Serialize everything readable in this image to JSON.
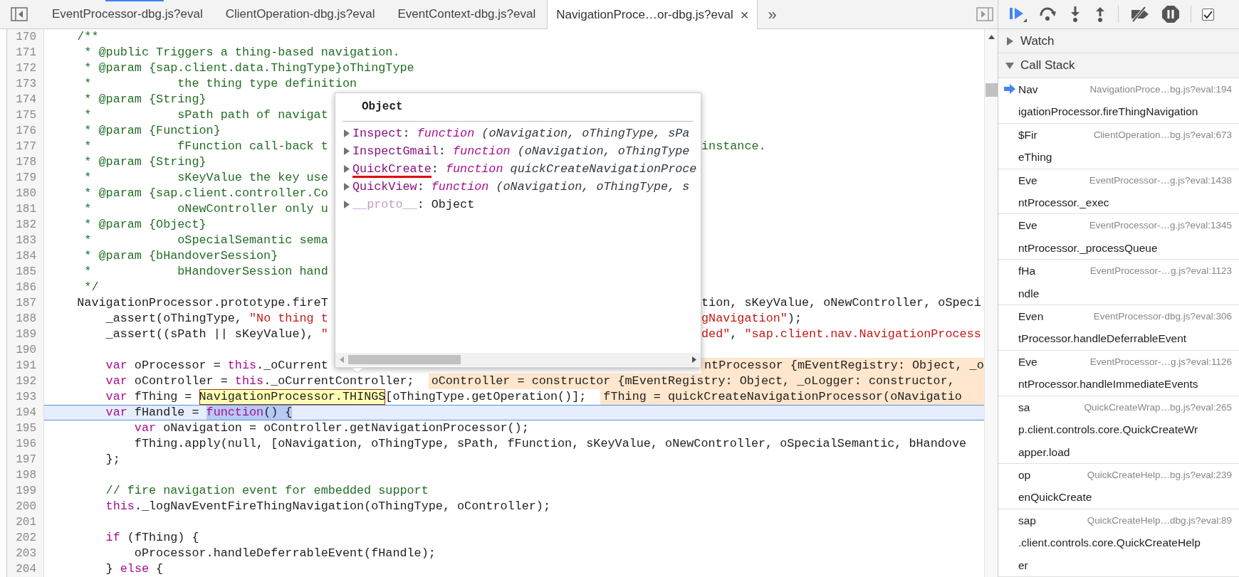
{
  "editor": {
    "tabs": [
      {
        "label": "EventProcessor-dbg.js?eval",
        "selected": false
      },
      {
        "label": "ClientOperation-dbg.js?eval",
        "selected": false
      },
      {
        "label": "EventContext-dbg.js?eval",
        "selected": false
      },
      {
        "label": "NavigationProce…or-dbg.js?eval",
        "selected": true,
        "close": "×"
      }
    ],
    "more": "»",
    "lines": [
      {
        "number": "170",
        "current": false,
        "left": [
          {
            "text": "    /**",
            "kind": "comment"
          }
        ]
      },
      {
        "number": "171",
        "current": false,
        "left": [
          {
            "text": "     * @public Triggers a thing-based navigation.",
            "kind": "comment"
          }
        ]
      },
      {
        "number": "172",
        "current": false,
        "left": [
          {
            "text": "     * @param {sap.client.data.ThingType}oThingType",
            "kind": "comment"
          }
        ]
      },
      {
        "number": "173",
        "current": false,
        "left": [
          {
            "text": "     *            the thing type definition",
            "kind": "comment"
          }
        ]
      },
      {
        "number": "174",
        "current": false,
        "left": [
          {
            "text": "     * @param {String}",
            "kind": "comment"
          }
        ]
      },
      {
        "number": "175",
        "current": false,
        "left": [
          {
            "text": "     *            sPath path of navigat",
            "kind": "comment"
          }
        ]
      },
      {
        "number": "176",
        "current": false,
        "left": [
          {
            "text": "     * @param {Function}",
            "kind": "comment"
          }
        ]
      },
      {
        "number": "177",
        "current": false,
        "left": [
          {
            "text": "     *            fFunction call-back t",
            "kind": "comment"
          }
        ],
        "right": [
          {
            "text": "instance.",
            "kind": "comment"
          }
        ]
      },
      {
        "number": "178",
        "current": false,
        "left": [
          {
            "text": "     * @param {String}",
            "kind": "comment"
          }
        ]
      },
      {
        "number": "179",
        "current": false,
        "left": [
          {
            "text": "     *            sKeyValue the key use",
            "kind": "comment"
          }
        ]
      },
      {
        "number": "180",
        "current": false,
        "left": [
          {
            "text": "     * @param {sap.client.controller.Co",
            "kind": "comment"
          }
        ]
      },
      {
        "number": "181",
        "current": false,
        "left": [
          {
            "text": "     *            oNewController only u",
            "kind": "comment"
          }
        ]
      },
      {
        "number": "182",
        "current": false,
        "left": [
          {
            "text": "     * @param {Object}",
            "kind": "comment"
          }
        ]
      },
      {
        "number": "183",
        "current": false,
        "left": [
          {
            "text": "     *            oSpecialSemantic sema",
            "kind": "comment"
          }
        ]
      },
      {
        "number": "184",
        "current": false,
        "left": [
          {
            "text": "     * @param {bHandoverSession}",
            "kind": "comment"
          }
        ]
      },
      {
        "number": "185",
        "current": false,
        "left": [
          {
            "text": "     *            bHandoverSession hand",
            "kind": "comment"
          }
        ]
      },
      {
        "number": "186",
        "current": false,
        "left": [
          {
            "text": "     */",
            "kind": "comment"
          }
        ]
      },
      {
        "number": "187",
        "current": false,
        "left": [
          {
            "text": "    NavigationProcessor.prototype.fireT",
            "kind": "plain"
          }
        ],
        "right": [
          {
            "text": "tion, sKeyValue, oNewController, oSpeci",
            "kind": "plain"
          }
        ]
      },
      {
        "number": "188",
        "current": false,
        "left": [
          {
            "text": "        _assert(oThingType, ",
            "kind": "plain"
          },
          {
            "text": "\"No thing t",
            "kind": "string"
          }
        ],
        "right": [
          {
            "text": "gNavigation\"",
            "kind": "string"
          },
          {
            "text": ");",
            "kind": "plain"
          }
        ]
      },
      {
        "number": "189",
        "current": false,
        "left": [
          {
            "text": "        _assert((sPath || sKeyValue), ",
            "kind": "plain"
          },
          {
            "text": "\"",
            "kind": "string"
          }
        ],
        "right": [
          {
            "text": "ded\"",
            "kind": "string"
          },
          {
            "text": ", ",
            "kind": "plain"
          },
          {
            "text": "\"sap.client.nav.NavigationProcess",
            "kind": "string"
          }
        ]
      },
      {
        "number": "190",
        "current": false
      },
      {
        "number": "191",
        "current": false,
        "left": [
          {
            "text": "        var",
            "kind": "keyword"
          },
          {
            "text": " oProcessor = ",
            "kind": "plain"
          },
          {
            "text": "this",
            "kind": "keyword"
          },
          {
            "text": "._oCurrent",
            "kind": "plain"
          }
        ],
        "right": [
          {
            "text": "ntProcessor {mEventRegistry: Object, _o",
            "kind": "inline"
          }
        ]
      },
      {
        "number": "192",
        "current": false,
        "left": [
          {
            "text": "        var",
            "kind": "keyword"
          },
          {
            "text": " oController = ",
            "kind": "plain"
          },
          {
            "text": "this",
            "kind": "keyword"
          },
          {
            "text": "._oCurrentController;",
            "kind": "plain"
          },
          {
            "text": "oController = constructor {mEventRegistry: Object, _oLogger: constructor, ",
            "kind": "inline"
          }
        ]
      },
      {
        "number": "193",
        "current": false,
        "left": [
          {
            "text": "        var",
            "kind": "keyword"
          },
          {
            "text": " fThing = ",
            "kind": "plain"
          },
          {
            "text": "NavigationProcessor.THINGS",
            "kind": "hover"
          },
          {
            "text": "[oThingType.getOperation()];",
            "kind": "plain"
          },
          {
            "text": "fThing = quickCreateNavigationProcessor(oNavigatio",
            "kind": "inline"
          }
        ]
      },
      {
        "number": "194",
        "current": true,
        "left": [
          {
            "text": "        var",
            "kind": "keyword"
          },
          {
            "text": " fHandle = ",
            "kind": "plain"
          },
          {
            "text": "function",
            "kind": "selkw"
          },
          {
            "text": "() {",
            "kind": "selection"
          }
        ]
      },
      {
        "number": "195",
        "current": false,
        "left": [
          {
            "text": "            var",
            "kind": "keyword"
          },
          {
            "text": " oNavigation = oController.getNavigationProcessor();",
            "kind": "plain"
          }
        ]
      },
      {
        "number": "196",
        "current": false,
        "left": [
          {
            "text": "            fThing.apply(null, [oNavigation, oThingType, sPath, fFunction, sKeyValue, oNewController, oSpecialSemantic, bHandove",
            "kind": "plain"
          }
        ]
      },
      {
        "number": "197",
        "current": false,
        "left": [
          {
            "text": "        };",
            "kind": "plain"
          }
        ]
      },
      {
        "number": "198",
        "current": false
      },
      {
        "number": "199",
        "current": false,
        "left": [
          {
            "text": "        // fire navigation event for embedded support",
            "kind": "comment"
          }
        ]
      },
      {
        "number": "200",
        "current": false,
        "left": [
          {
            "text": "        this",
            "kind": "keyword"
          },
          {
            "text": "._logNavEventFireThingNavigation(oThingType, oController);",
            "kind": "plain"
          }
        ]
      },
      {
        "number": "201",
        "current": false
      },
      {
        "number": "202",
        "current": false,
        "left": [
          {
            "text": "        if",
            "kind": "keyword"
          },
          {
            "text": " (fThing) {",
            "kind": "plain"
          }
        ]
      },
      {
        "number": "203",
        "current": false,
        "left": [
          {
            "text": "            oProcessor.handleDeferrableEvent(fHandle);",
            "kind": "plain"
          }
        ]
      },
      {
        "number": "204",
        "current": false,
        "left": [
          {
            "text": "        } ",
            "kind": "plain"
          },
          {
            "text": "else",
            "kind": "keyword"
          },
          {
            "text": " {",
            "kind": "plain"
          }
        ]
      }
    ],
    "popover": {
      "title": "Object",
      "rows": [
        {
          "underlined": false,
          "parts": [
            {
              "text": "Inspect",
              "kind": "prop"
            },
            {
              "text": ": ",
              "kind": "punct"
            },
            {
              "text": "function",
              "kind": "fnkw"
            },
            {
              "text": " (oNavigation, oThingType, sPa",
              "kind": "italic"
            }
          ]
        },
        {
          "underlined": false,
          "parts": [
            {
              "text": "InspectGmail",
              "kind": "prop"
            },
            {
              "text": ": ",
              "kind": "punct"
            },
            {
              "text": "function",
              "kind": "fnkw"
            },
            {
              "text": " (oNavigation, oThingType",
              "kind": "italic"
            }
          ]
        },
        {
          "underlined": true,
          "parts": [
            {
              "text": "QuickCreate",
              "kind": "prop"
            },
            {
              "text": ": ",
              "kind": "punct"
            },
            {
              "text": "function",
              "kind": "fnkw"
            },
            {
              "text": " quickCreateNavigationProce",
              "kind": "italic"
            }
          ]
        },
        {
          "underlined": false,
          "parts": [
            {
              "text": "QuickView",
              "kind": "prop"
            },
            {
              "text": ": ",
              "kind": "punct"
            },
            {
              "text": "function",
              "kind": "fnkw"
            },
            {
              "text": " (oNavigation, oThingType, s",
              "kind": "italic"
            }
          ]
        },
        {
          "underlined": false,
          "parts": [
            {
              "text": "__proto__",
              "kind": "proto"
            },
            {
              "text": ": Object",
              "kind": "punct"
            }
          ]
        }
      ]
    }
  },
  "debugger": {
    "pause_on_caught": {
      "checked": true
    },
    "watch": {
      "label": "Watch",
      "expanded": false
    },
    "call_stack": {
      "label": "Call Stack",
      "expanded": true,
      "frames": [
        {
          "name_lines": [
            "Nav",
            "igationProcessor.fireThingNavigation"
          ],
          "location": "NavigationProce…bg.js?eval:194",
          "selected": true
        },
        {
          "name_lines": [
            "$Fir",
            "eThing"
          ],
          "location": "ClientOperation…bg.js?eval:673",
          "selected": false
        },
        {
          "name_lines": [
            "Eve",
            "ntProcessor._exec"
          ],
          "location": "EventProcessor-…g.js?eval:1438",
          "selected": false
        },
        {
          "name_lines": [
            "Eve",
            "ntProcessor._processQueue"
          ],
          "location": "EventProcessor-…g.js?eval:1345",
          "selected": false
        },
        {
          "name_lines": [
            "fHa",
            "ndle"
          ],
          "location": "EventProcessor-…g.js?eval:1123",
          "selected": false
        },
        {
          "name_lines": [
            "Even",
            "tProcessor.handleDeferrableEvent"
          ],
          "location": "EventProcessor-dbg.js?eval:306",
          "selected": false
        },
        {
          "name_lines": [
            "Eve",
            "ntProcessor.handleImmediateEvents"
          ],
          "location": "EventProcessor-…g.js?eval:1126",
          "selected": false
        },
        {
          "name_lines": [
            "sa",
            "p.client.controls.core.QuickCreateWr",
            "apper.load"
          ],
          "location": "QuickCreateWrap…bg.js?eval:265",
          "selected": false
        },
        {
          "name_lines": [
            "op",
            "enQuickCreate"
          ],
          "location": "QuickCreateHelp…bg.js?eval:239",
          "selected": false
        },
        {
          "name_lines": [
            "sap",
            ".client.controls.core.QuickCreateHelp",
            "er"
          ],
          "location": "QuickCreateHelp…dbg.js?eval:89",
          "selected": false
        }
      ]
    }
  }
}
